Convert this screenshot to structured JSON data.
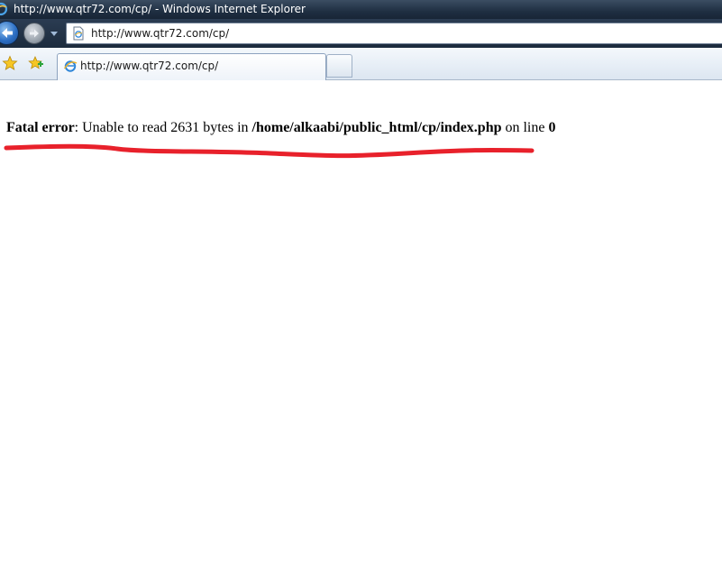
{
  "window": {
    "title": "http://www.qtr72.com/cp/ - Windows Internet Explorer"
  },
  "navigation": {
    "back_icon": "back-arrow-icon",
    "forward_icon": "forward-arrow-icon",
    "dropdown_icon": "chevron-down-icon"
  },
  "address_bar": {
    "url": "http://www.qtr72.com/cp/",
    "icon": "page-icon"
  },
  "tabs": [
    {
      "label": "http://www.qtr72.com/cp/",
      "icon": "ie-page-icon",
      "active": true
    }
  ],
  "favorites": {
    "favorites_icon": "star-icon",
    "add_favorites_icon": "add-favorite-icon"
  },
  "page": {
    "error_label": "Fatal error",
    "message_prefix": ": Unable to read 2631 bytes in ",
    "file_path": "/home/alkaabi/public_html/cp/index.php",
    "line_prefix": " on line ",
    "line_number": "0"
  },
  "colors": {
    "underline": "#e8212b",
    "titlebar": "#1f2f42"
  }
}
